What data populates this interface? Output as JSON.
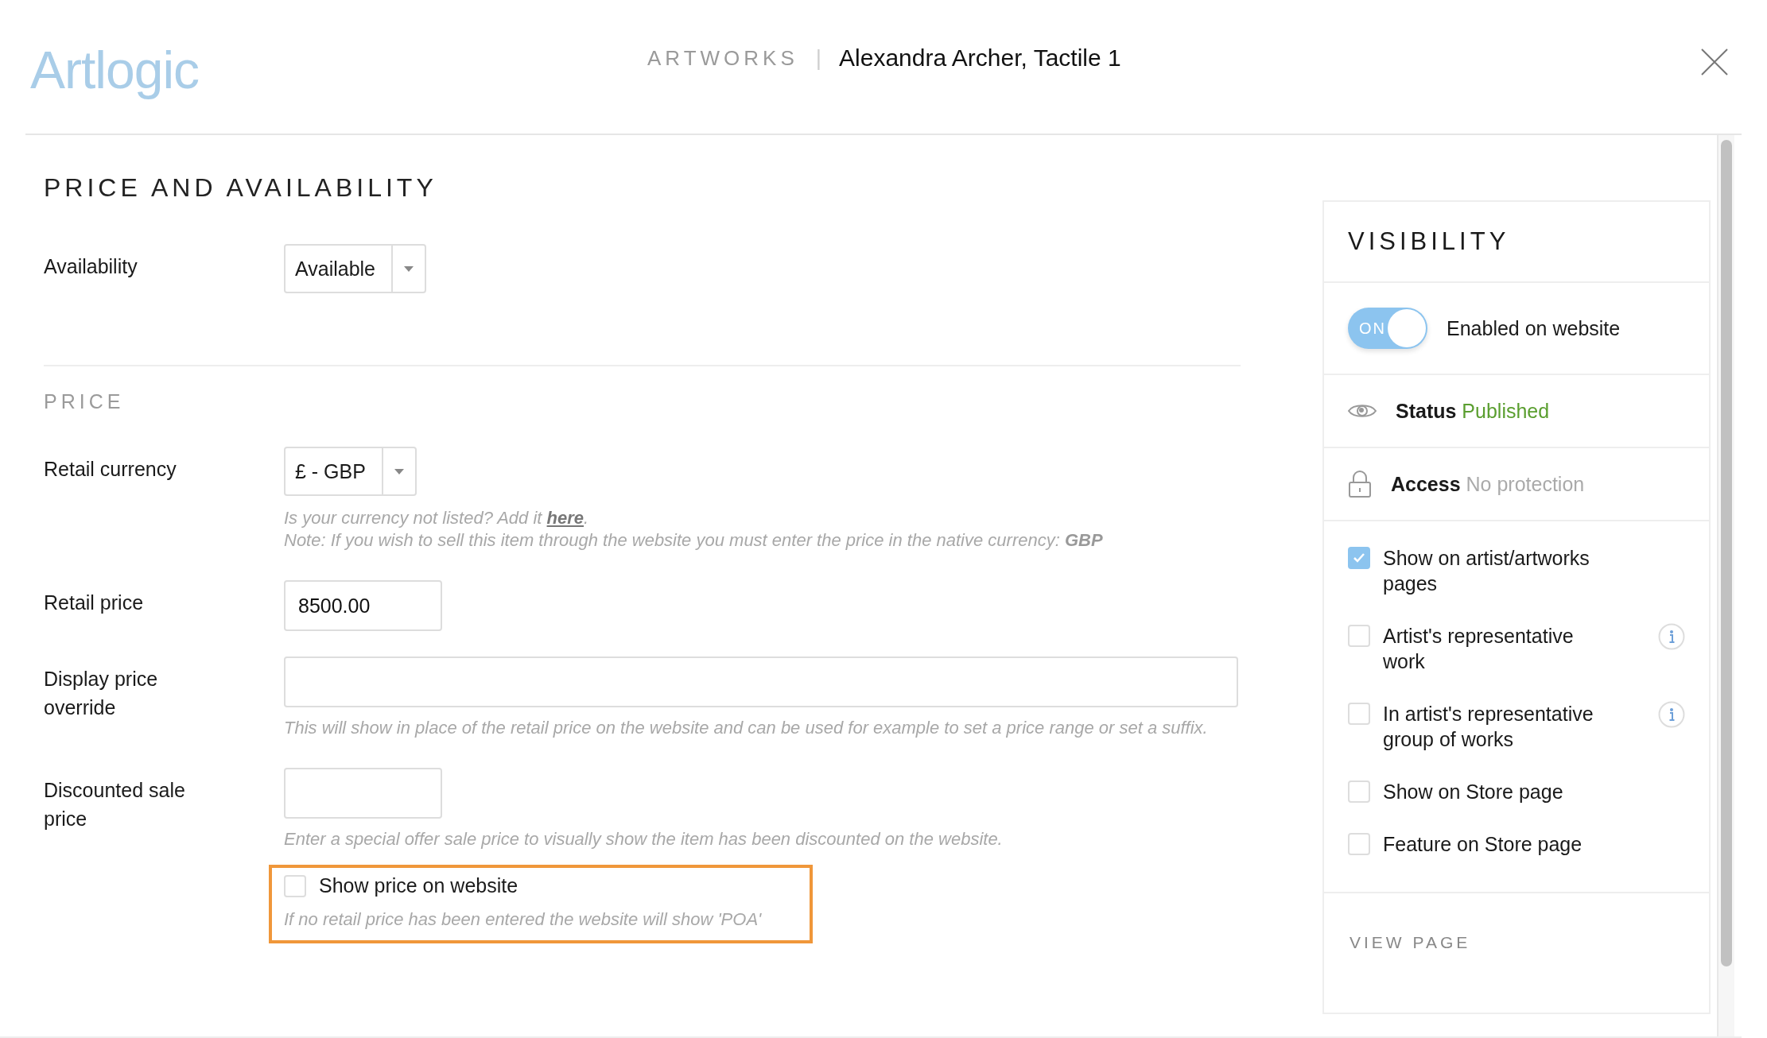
{
  "header": {
    "logo": "Artlogic",
    "section": "ARTWORKS",
    "separator": "|",
    "title": "Alexandra Archer, Tactile 1"
  },
  "price_and_availability": {
    "title": "PRICE AND AVAILABILITY",
    "availability": {
      "label": "Availability",
      "value": "Available"
    },
    "price": {
      "heading": "PRICE",
      "currency": {
        "label": "Retail currency",
        "value": "£ - GBP",
        "help_before": "Is your currency not listed? Add it ",
        "help_link": "here",
        "help_after": ".",
        "note": "Note: If you wish to sell this item through the website you must enter the price in the native currency: **GBP**"
      },
      "retail_price": {
        "label": "Retail price",
        "value": "8500.00"
      },
      "display_override": {
        "label": "Display price override",
        "help": "This will show in place of the retail price on the website and can be used for example to set a price range or set a suffix."
      },
      "discounted": {
        "label": "Discounted sale price",
        "help": "Enter a special offer sale price to visually show the item has been discounted on the website."
      },
      "show_price": {
        "label": "Show price on website",
        "checked": false,
        "help": "If no retail price has been entered the website will show 'POA'"
      }
    }
  },
  "visibility": {
    "title": "VISIBILITY",
    "toggle": {
      "on": true,
      "text": "ON",
      "label": "Enabled on website"
    },
    "info_rows": [
      {
        "kind": "status",
        "label": "Status",
        "value": "Published"
      },
      {
        "kind": "access",
        "label": "Access",
        "value": "No protection"
      }
    ],
    "options": [
      {
        "label": "Show on artist/artworks pages",
        "checked": true,
        "info": false
      },
      {
        "label": "Artist's representative work",
        "checked": false,
        "info": true
      },
      {
        "label": "In artist's representative group of works",
        "checked": false,
        "info": true
      },
      {
        "label": "Show on Store page",
        "checked": false,
        "info": false
      },
      {
        "label": "Feature on Store page",
        "checked": false,
        "info": false
      }
    ],
    "link": "VIEW PAGE"
  }
}
